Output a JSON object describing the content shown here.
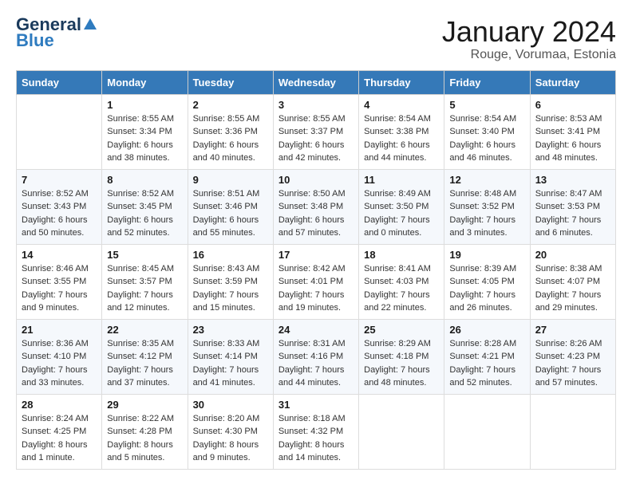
{
  "header": {
    "logo_general": "General",
    "logo_blue": "Blue",
    "month_title": "January 2024",
    "subtitle": "Rouge, Vorumaa, Estonia"
  },
  "days_of_week": [
    "Sunday",
    "Monday",
    "Tuesday",
    "Wednesday",
    "Thursday",
    "Friday",
    "Saturday"
  ],
  "weeks": [
    [
      {
        "day": "",
        "sunrise": "",
        "sunset": "",
        "daylight": ""
      },
      {
        "day": "1",
        "sunrise": "Sunrise: 8:55 AM",
        "sunset": "Sunset: 3:34 PM",
        "daylight": "Daylight: 6 hours and 38 minutes."
      },
      {
        "day": "2",
        "sunrise": "Sunrise: 8:55 AM",
        "sunset": "Sunset: 3:36 PM",
        "daylight": "Daylight: 6 hours and 40 minutes."
      },
      {
        "day": "3",
        "sunrise": "Sunrise: 8:55 AM",
        "sunset": "Sunset: 3:37 PM",
        "daylight": "Daylight: 6 hours and 42 minutes."
      },
      {
        "day": "4",
        "sunrise": "Sunrise: 8:54 AM",
        "sunset": "Sunset: 3:38 PM",
        "daylight": "Daylight: 6 hours and 44 minutes."
      },
      {
        "day": "5",
        "sunrise": "Sunrise: 8:54 AM",
        "sunset": "Sunset: 3:40 PM",
        "daylight": "Daylight: 6 hours and 46 minutes."
      },
      {
        "day": "6",
        "sunrise": "Sunrise: 8:53 AM",
        "sunset": "Sunset: 3:41 PM",
        "daylight": "Daylight: 6 hours and 48 minutes."
      }
    ],
    [
      {
        "day": "7",
        "sunrise": "Sunrise: 8:52 AM",
        "sunset": "Sunset: 3:43 PM",
        "daylight": "Daylight: 6 hours and 50 minutes."
      },
      {
        "day": "8",
        "sunrise": "Sunrise: 8:52 AM",
        "sunset": "Sunset: 3:45 PM",
        "daylight": "Daylight: 6 hours and 52 minutes."
      },
      {
        "day": "9",
        "sunrise": "Sunrise: 8:51 AM",
        "sunset": "Sunset: 3:46 PM",
        "daylight": "Daylight: 6 hours and 55 minutes."
      },
      {
        "day": "10",
        "sunrise": "Sunrise: 8:50 AM",
        "sunset": "Sunset: 3:48 PM",
        "daylight": "Daylight: 6 hours and 57 minutes."
      },
      {
        "day": "11",
        "sunrise": "Sunrise: 8:49 AM",
        "sunset": "Sunset: 3:50 PM",
        "daylight": "Daylight: 7 hours and 0 minutes."
      },
      {
        "day": "12",
        "sunrise": "Sunrise: 8:48 AM",
        "sunset": "Sunset: 3:52 PM",
        "daylight": "Daylight: 7 hours and 3 minutes."
      },
      {
        "day": "13",
        "sunrise": "Sunrise: 8:47 AM",
        "sunset": "Sunset: 3:53 PM",
        "daylight": "Daylight: 7 hours and 6 minutes."
      }
    ],
    [
      {
        "day": "14",
        "sunrise": "Sunrise: 8:46 AM",
        "sunset": "Sunset: 3:55 PM",
        "daylight": "Daylight: 7 hours and 9 minutes."
      },
      {
        "day": "15",
        "sunrise": "Sunrise: 8:45 AM",
        "sunset": "Sunset: 3:57 PM",
        "daylight": "Daylight: 7 hours and 12 minutes."
      },
      {
        "day": "16",
        "sunrise": "Sunrise: 8:43 AM",
        "sunset": "Sunset: 3:59 PM",
        "daylight": "Daylight: 7 hours and 15 minutes."
      },
      {
        "day": "17",
        "sunrise": "Sunrise: 8:42 AM",
        "sunset": "Sunset: 4:01 PM",
        "daylight": "Daylight: 7 hours and 19 minutes."
      },
      {
        "day": "18",
        "sunrise": "Sunrise: 8:41 AM",
        "sunset": "Sunset: 4:03 PM",
        "daylight": "Daylight: 7 hours and 22 minutes."
      },
      {
        "day": "19",
        "sunrise": "Sunrise: 8:39 AM",
        "sunset": "Sunset: 4:05 PM",
        "daylight": "Daylight: 7 hours and 26 minutes."
      },
      {
        "day": "20",
        "sunrise": "Sunrise: 8:38 AM",
        "sunset": "Sunset: 4:07 PM",
        "daylight": "Daylight: 7 hours and 29 minutes."
      }
    ],
    [
      {
        "day": "21",
        "sunrise": "Sunrise: 8:36 AM",
        "sunset": "Sunset: 4:10 PM",
        "daylight": "Daylight: 7 hours and 33 minutes."
      },
      {
        "day": "22",
        "sunrise": "Sunrise: 8:35 AM",
        "sunset": "Sunset: 4:12 PM",
        "daylight": "Daylight: 7 hours and 37 minutes."
      },
      {
        "day": "23",
        "sunrise": "Sunrise: 8:33 AM",
        "sunset": "Sunset: 4:14 PM",
        "daylight": "Daylight: 7 hours and 41 minutes."
      },
      {
        "day": "24",
        "sunrise": "Sunrise: 8:31 AM",
        "sunset": "Sunset: 4:16 PM",
        "daylight": "Daylight: 7 hours and 44 minutes."
      },
      {
        "day": "25",
        "sunrise": "Sunrise: 8:29 AM",
        "sunset": "Sunset: 4:18 PM",
        "daylight": "Daylight: 7 hours and 48 minutes."
      },
      {
        "day": "26",
        "sunrise": "Sunrise: 8:28 AM",
        "sunset": "Sunset: 4:21 PM",
        "daylight": "Daylight: 7 hours and 52 minutes."
      },
      {
        "day": "27",
        "sunrise": "Sunrise: 8:26 AM",
        "sunset": "Sunset: 4:23 PM",
        "daylight": "Daylight: 7 hours and 57 minutes."
      }
    ],
    [
      {
        "day": "28",
        "sunrise": "Sunrise: 8:24 AM",
        "sunset": "Sunset: 4:25 PM",
        "daylight": "Daylight: 8 hours and 1 minute."
      },
      {
        "day": "29",
        "sunrise": "Sunrise: 8:22 AM",
        "sunset": "Sunset: 4:28 PM",
        "daylight": "Daylight: 8 hours and 5 minutes."
      },
      {
        "day": "30",
        "sunrise": "Sunrise: 8:20 AM",
        "sunset": "Sunset: 4:30 PM",
        "daylight": "Daylight: 8 hours and 9 minutes."
      },
      {
        "day": "31",
        "sunrise": "Sunrise: 8:18 AM",
        "sunset": "Sunset: 4:32 PM",
        "daylight": "Daylight: 8 hours and 14 minutes."
      },
      {
        "day": "",
        "sunrise": "",
        "sunset": "",
        "daylight": ""
      },
      {
        "day": "",
        "sunrise": "",
        "sunset": "",
        "daylight": ""
      },
      {
        "day": "",
        "sunrise": "",
        "sunset": "",
        "daylight": ""
      }
    ]
  ]
}
